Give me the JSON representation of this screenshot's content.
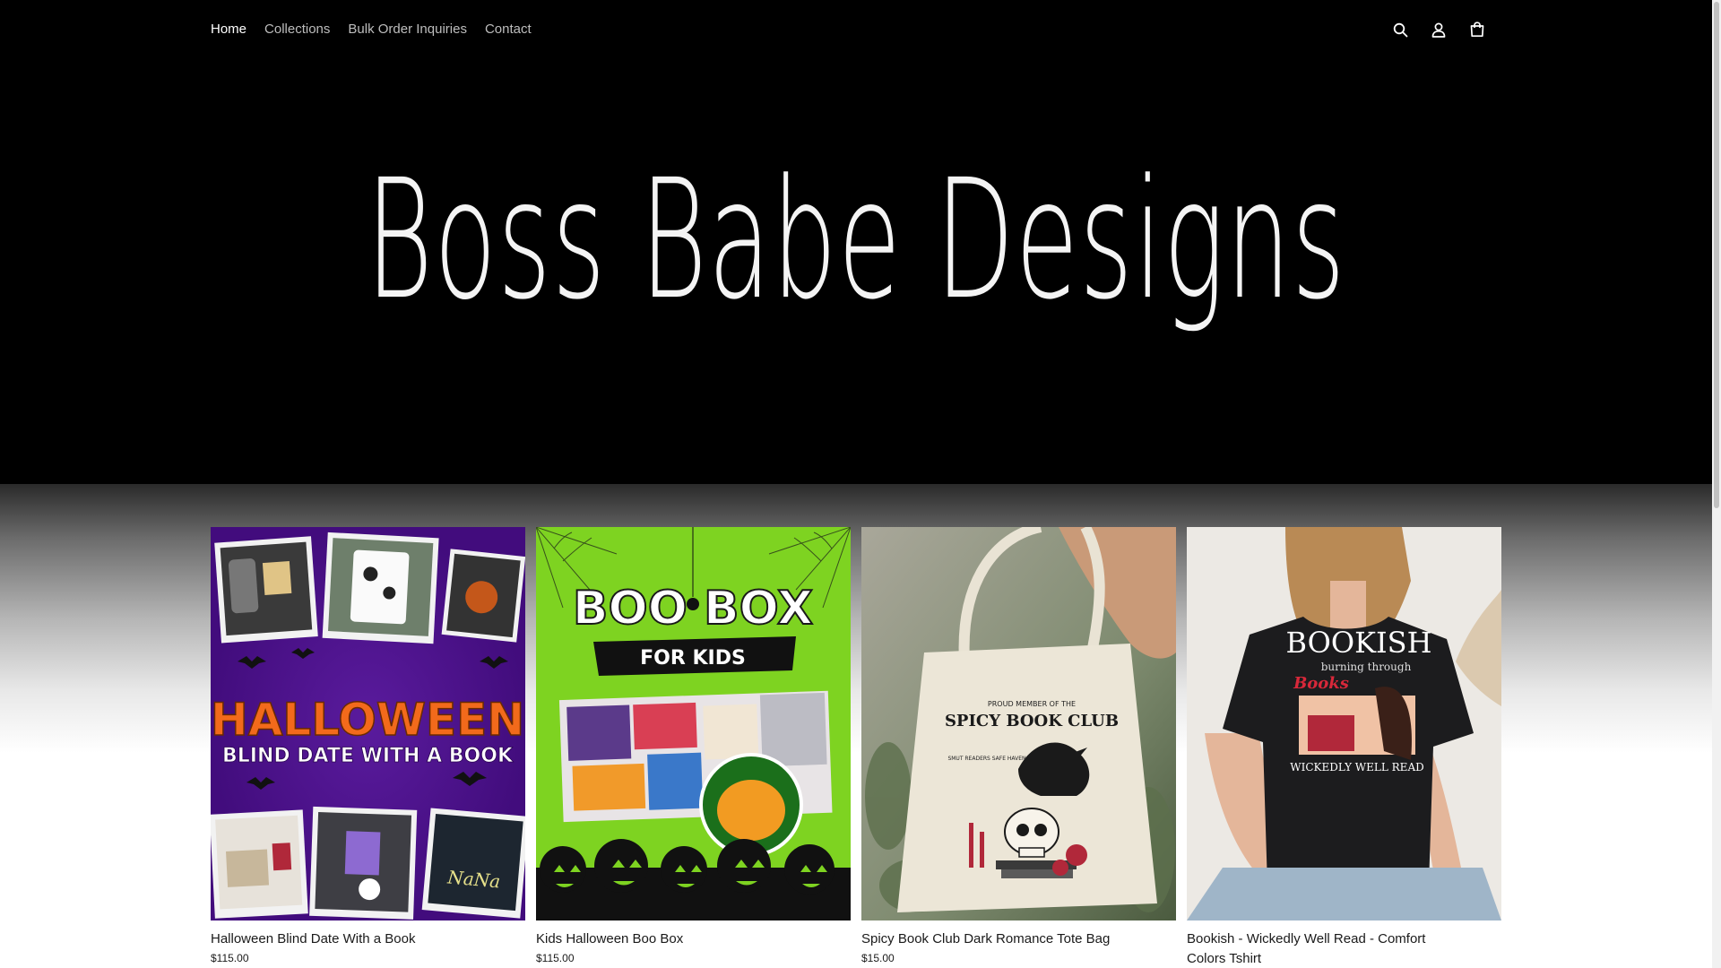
{
  "nav": {
    "items": [
      {
        "label": "Home",
        "active": true
      },
      {
        "label": "Collections",
        "active": false
      },
      {
        "label": "Bulk Order Inquiries",
        "active": false
      },
      {
        "label": "Contact",
        "active": false
      }
    ]
  },
  "header_icons": [
    "search-icon",
    "account-icon",
    "cart-icon"
  ],
  "hero": {
    "brand": "Boss Babe Designs"
  },
  "products": [
    {
      "title": "Halloween Blind Date With a Book",
      "price": "$115.00",
      "image": {
        "headline": "HALLOWEEN",
        "subline": "BLIND DATE WITH A BOOK",
        "tag": "NaNa",
        "bg": "#4a0f8c",
        "accent": "#f26a1b"
      }
    },
    {
      "title": "Kids Halloween Boo Box",
      "price": "$115.00",
      "image": {
        "headline": "BOO BOX",
        "subline": "FOR KIDS",
        "bg": "#7ed321"
      }
    },
    {
      "title": "Spicy Book Club Dark Romance Tote Bag",
      "price": "$15.00",
      "image": {
        "top": "PROUD MEMBER OF THE",
        "headline": "SPICY BOOK CLUB",
        "subline": "SMUT READERS SAFE HAVEN"
      }
    },
    {
      "title": "Bookish - Wickedly Well Read - Comfort Colors Tshirt",
      "price": "",
      "image": {
        "headline": "BOOKISH",
        "middle": "burning through",
        "accent_word": "Books",
        "subline": "WICKEDLY WELL READ"
      }
    }
  ],
  "colors": {
    "header_bg": "#000000",
    "nav_active": "#ffffff",
    "nav_inactive": "#bdbdbd"
  }
}
